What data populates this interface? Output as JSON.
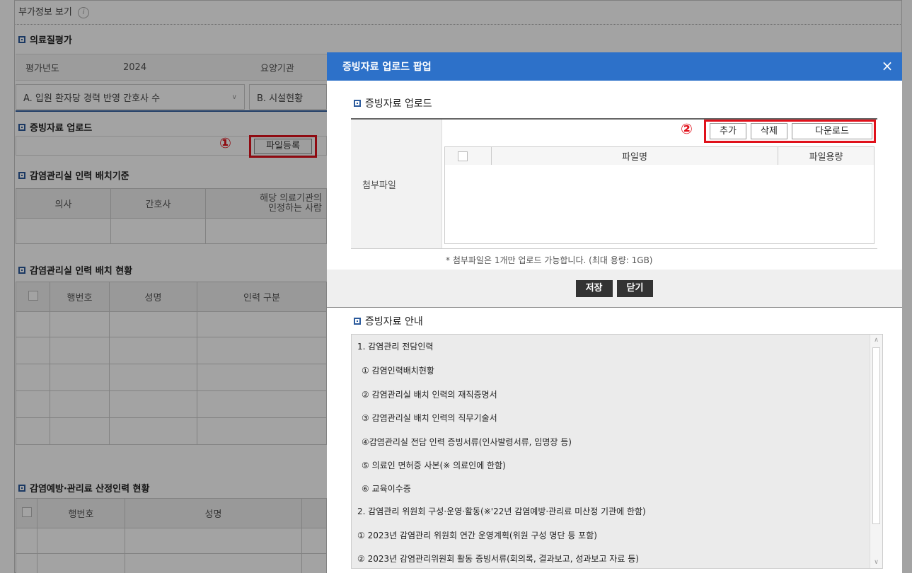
{
  "background": {
    "page_title": "부가정보 보기",
    "info_icon": "i",
    "section_quality": "의료질평가",
    "field_year_label": "평가년도",
    "field_year_value": "2024",
    "field_institution_label": "요양기관",
    "select_a": "A. 입원 환자당 경력 반영 간호사 수",
    "select_b": "B. 시설현황",
    "section_upload": "증빙자료 업로드",
    "file_register_button": "파일등록",
    "marker_1": "①",
    "section_staff_criteria": "감염관리실 인력 배치기준",
    "criteria_headers": [
      "의사",
      "간호사",
      "해당 의료기관의",
      "인정하는 사람"
    ],
    "section_staff_status": "감염관리실 인력 배치 현황",
    "status_headers": [
      "행번호",
      "성명",
      "인력 구분"
    ],
    "section_prevention": "감염예방·관리료 산정인력 현황",
    "prevention_headers": [
      "행번호",
      "성명"
    ]
  },
  "popup": {
    "title": "증빙자료 업로드 팝업",
    "close_icon": "×",
    "section_upload": "증빙자료 업로드",
    "attach_label": "첨부파일",
    "marker_2": "②",
    "buttons": {
      "add": "추가",
      "delete": "삭제",
      "download": "다운로드"
    },
    "table_headers": {
      "filename": "파일명",
      "filesize": "파일용량"
    },
    "note": "* 첨부파일은 1개만 업로드 가능합니다. (최대 용량: 1GB)",
    "save_button": "저장",
    "close_button": "닫기",
    "section_guide": "증빙자료 안내",
    "guide_items": [
      "1. 감염관리 전담인력",
      "① 감염인력배치현황",
      "② 감염관리실 배치 인력의 재직증명서",
      "③ 감염관리실 배치 인력의 직무기술서",
      "④감염관리실 전담 인력 증빙서류(인사발령서류, 임명장 등)",
      "⑤ 의료인 면허증 사본(※ 의료인에 한함)",
      "⑥ 교육이수증",
      "2. 감염관리 위원회 구성·운영·활동(※'22년 감염예방·관리료 미산정 기관에 한함)",
      "① 2023년 감염관리 위원회 연간 운영계획(위원 구성 명단 등 포함)",
      "② 2023년 감염관리위원회 활동 증빙서류(회의록, 결과보고, 성과보고 자료 등)"
    ]
  },
  "colors": {
    "accent": "#2d71c9",
    "highlight": "#e0111b",
    "section_square": "#2b5a9c"
  },
  "icons": {
    "close": "close-icon",
    "chevron": "chevron-down-icon",
    "info": "info-icon",
    "section": "section-square-icon"
  }
}
